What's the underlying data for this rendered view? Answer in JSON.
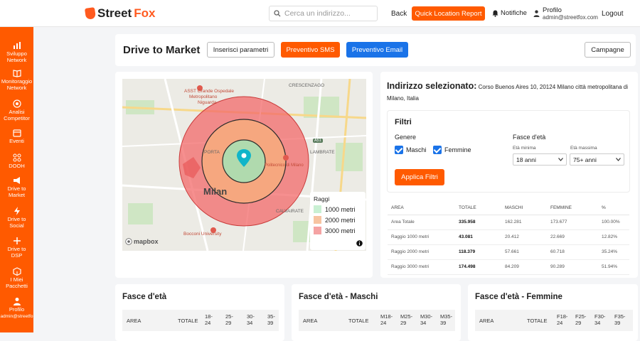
{
  "topbar": {
    "brand_street": "Street",
    "brand_fox": "Fox",
    "search_placeholder": "Cerca un indirizzo...",
    "back": "Back",
    "quick_report": "Quick Location Report",
    "notifications": "Notifiche",
    "profile_name": "Profilo",
    "profile_email": "admin@streetfox.com",
    "logout": "Logout"
  },
  "sidebar": {
    "items": [
      {
        "label1": "Sviluppo",
        "label2": "Network",
        "icon": "chart-icon"
      },
      {
        "label1": "Monitoraggio",
        "label2": "Network",
        "icon": "book-icon"
      },
      {
        "label1": "Analisi",
        "label2": "Competitor",
        "icon": "target-icon"
      },
      {
        "label1": "Eventi",
        "label2": "",
        "icon": "calendar-icon"
      },
      {
        "label1": "DOOH",
        "label2": "",
        "icon": "grid-icon"
      },
      {
        "label1": "Drive to",
        "label2": "Market",
        "icon": "megaphone-icon"
      },
      {
        "label1": "Drive to",
        "label2": "Social",
        "icon": "lightning-icon"
      },
      {
        "label1": "Drive to",
        "label2": "DSP",
        "icon": "plus-icon"
      },
      {
        "label1": "I Miei",
        "label2": "Pacchetti",
        "icon": "package-icon"
      },
      {
        "label1": "Profilo",
        "label2": "admin@streetfo",
        "icon": "user-icon"
      }
    ]
  },
  "header": {
    "title": "Drive to Market",
    "btn_params": "Inserisci parametri",
    "btn_sms": "Preventivo SMS",
    "btn_email": "Preventivo Email",
    "btn_campaigns": "Campagne"
  },
  "map": {
    "city": "Milan",
    "labels": {
      "asst": "ASST Grande Ospedale",
      "asst2": "Metropolitano",
      "asst3": "Niguarda",
      "crescenzago": "CRESCENZAGO",
      "lambrate": "LAMBRATE",
      "calvairate": "CALVAIRATE",
      "porta": "PORTA",
      "poli": "Politecnico di Milano",
      "bocconi": "Bocconi University",
      "mapbox": "mapbox",
      "a51": "A51"
    },
    "legend_title": "Raggi",
    "legend": [
      {
        "label": "1000 metri",
        "color": "#c9f0d3"
      },
      {
        "label": "2000 metri",
        "color": "#f7c4a1"
      },
      {
        "label": "3000 metri",
        "color": "#f5a3a3"
      }
    ]
  },
  "address": {
    "label": "Indirizzo selezionato:",
    "value": "Corso Buenos Aires 10, 20124 Milano città metropolitana di Milano, Italia"
  },
  "filters": {
    "title": "Filtri",
    "gender_label": "Genere",
    "male": "Maschi",
    "female": "Femmine",
    "age_label": "Fasce d'età",
    "min_label": "Età minima",
    "max_label": "Età massima",
    "min_value": "18 anni",
    "max_value": "75+ anni",
    "apply": "Applica Filtri"
  },
  "area_table": {
    "headers": [
      "AREA",
      "TOTALE",
      "MASCHI",
      "FEMMINE",
      "%"
    ],
    "rows": [
      [
        "Area Totale",
        "335.958",
        "162.281",
        "173.677",
        "100.00%"
      ],
      [
        "Raggio 1000 metri",
        "43.081",
        "20.412",
        "22.669",
        "12.82%"
      ],
      [
        "Raggio 2000 metri",
        "118.379",
        "57.661",
        "60.718",
        "35.24%"
      ],
      [
        "Raggio 3000 metri",
        "174.498",
        "84.209",
        "90.289",
        "51.94%"
      ]
    ]
  },
  "age_cards": [
    {
      "title": "Fasce d'età",
      "cols": [
        "AREA",
        "TOTALE",
        "18-\n24",
        "25-\n29",
        "30-\n34",
        "35-\n39"
      ]
    },
    {
      "title": "Fasce d'età - Maschi",
      "cols": [
        "AREA",
        "TOTALE",
        "M18-\n24",
        "M25-\n29",
        "M30-\n34",
        "M35-\n39"
      ]
    },
    {
      "title": "Fasce d'età - Femmine",
      "cols": [
        "AREA",
        "TOTALE",
        "F18-\n24",
        "F25-\n29",
        "F30-\n34",
        "F35-\n39"
      ]
    }
  ]
}
